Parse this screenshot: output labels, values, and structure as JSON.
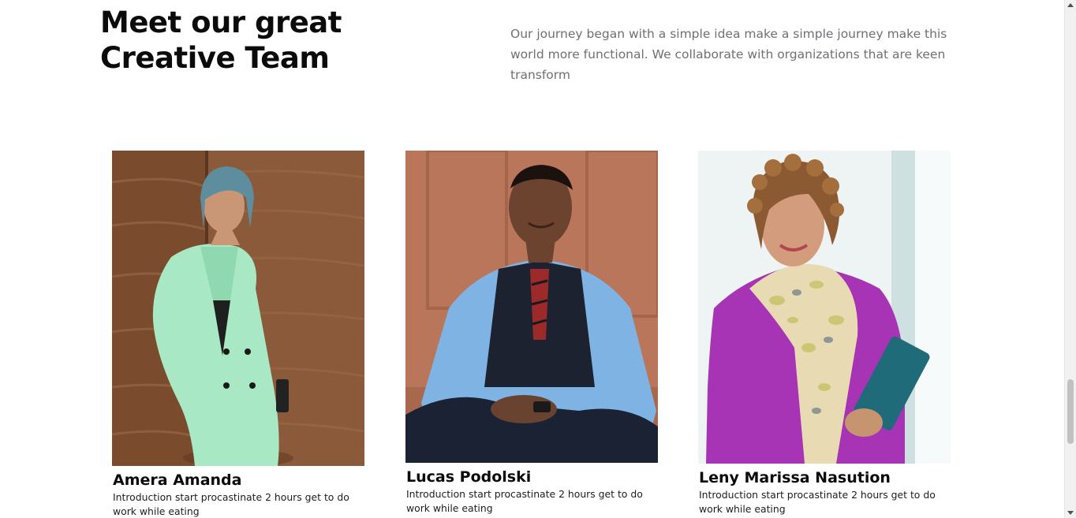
{
  "section": {
    "heading": "Meet our great Creative Team",
    "intro": "Our journey began with a simple idea make a simple journey make this world more functional. We collaborate with organizations that are keen transform"
  },
  "team": [
    {
      "name": "Amera Amanda",
      "bio": "Introduction start procastinate 2 hours get to do work while eating",
      "photo_icon": "portrait-woman-mint-suit"
    },
    {
      "name": "Lucas Podolski",
      "bio": "Introduction start procastinate 2 hours get to do work while eating",
      "photo_icon": "portrait-man-vest"
    },
    {
      "name": "Leny Marissa Nasution",
      "bio": "Introduction start procastinate 2 hours get to do work while eating",
      "photo_icon": "portrait-woman-purple-scarf"
    }
  ],
  "colors": {
    "heading": "#0b0b0b",
    "intro_text": "#6f6f75",
    "background": "#ffffff"
  }
}
